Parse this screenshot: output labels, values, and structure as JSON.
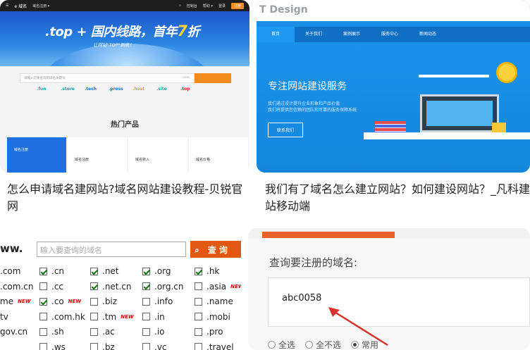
{
  "card1": {
    "caption": "怎么申请域名建网站?域名网站建设教程-贝锐官网",
    "nav": {
      "logo": "e 域名",
      "links": [
        "域名注册 ▾",
        "控制台",
        "帮助 ▾",
        "登录"
      ],
      "register": "注册"
    },
    "hero_title_pre": ".top + 国内线路，首年",
    "hero_title_num": "7",
    "hero_title_post": "折",
    "hero_sub": "让网站\"TOP\"到底！",
    "search_placeholder": "请输入您要查询的域名关键词",
    "search_select": ".com",
    "tlds": [
      ".fun",
      ".store",
      ".tech",
      ".press",
      ".host",
      ".site",
      ".top"
    ],
    "tld_colors": [
      "#1aa6a0",
      "#1aa6a0",
      "#1f6fe0",
      "#1f6fe0",
      "#e0a020",
      "#1aa6a0",
      "#e03030"
    ],
    "hot_title": "热门产品",
    "products": [
      "域名注册",
      "域名注册",
      "域名转入",
      "域名价格"
    ]
  },
  "card2": {
    "caption": "我们有了域名怎么建立网站？如何建设网站？_凡科建站移动端",
    "logo": "T Design",
    "menu": [
      "首页",
      "关于我们",
      "案例展示",
      "服务中心",
      "新闻动态"
    ],
    "banner_title": "专注网站建设服务",
    "banner_lines": [
      "我们通过设计提升企业形象和产品价值",
      "我们将提供您信赖的团队和可靠的服务保障系统"
    ],
    "banner_button": "联系我们"
  },
  "card3": {
    "www": "ww.",
    "search_placeholder": "输入要查询的域名",
    "search_button": "查询",
    "new_label": "NEW",
    "rows": [
      [
        {
          "t": ".com",
          "c": null
        },
        {
          "t": ".cn",
          "c": true
        },
        {
          "t": ".net",
          "c": true
        },
        {
          "t": ".org",
          "c": true
        },
        {
          "t": ".hk",
          "c": true
        }
      ],
      [
        {
          "t": ".com.cn",
          "c": null
        },
        {
          "t": ".cc",
          "c": false
        },
        {
          "t": ".net.cn",
          "c": true
        },
        {
          "t": ".org.cn",
          "c": true
        },
        {
          "t": ".asia",
          "c": false,
          "new": true
        }
      ],
      [
        {
          "t": "me",
          "c": null,
          "new": true
        },
        {
          "t": ".co",
          "c": true,
          "new": true
        },
        {
          "t": ".biz",
          "c": false
        },
        {
          "t": ".info",
          "c": false
        },
        {
          "t": ".name",
          "c": false
        }
      ],
      [
        {
          "t": "tv",
          "c": null
        },
        {
          "t": ".com.hk",
          "c": false
        },
        {
          "t": ".tm",
          "c": false,
          "new": true
        },
        {
          "t": ".in",
          "c": false
        },
        {
          "t": ".mobi",
          "c": false
        }
      ],
      [
        {
          "t": "gov.cn",
          "c": null
        },
        {
          "t": ".sh",
          "c": false
        },
        {
          "t": ".ac",
          "c": false
        },
        {
          "t": ".io",
          "c": false
        },
        {
          "t": ".pro",
          "c": false
        }
      ],
      [
        {
          "t": "",
          "c": null
        },
        {
          "t": ".ws",
          "c": false
        },
        {
          "t": ".bz",
          "c": false
        },
        {
          "t": ".vc",
          "c": false
        },
        {
          "t": ".travel",
          "c": false
        }
      ]
    ]
  },
  "card4": {
    "title": "查询要注册的域名:",
    "input_value": "abc0058",
    "options": [
      {
        "label": "全选",
        "on": false
      },
      {
        "label": "全不选",
        "on": false
      },
      {
        "label": "常用",
        "on": true
      }
    ]
  }
}
